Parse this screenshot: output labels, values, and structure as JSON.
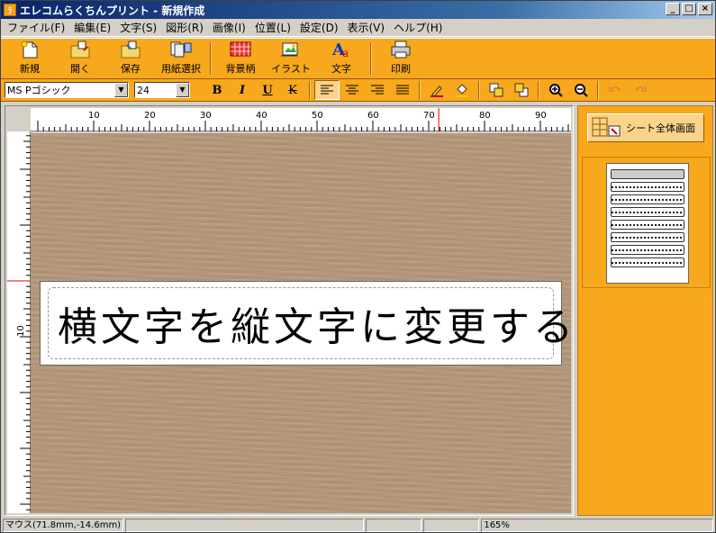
{
  "window": {
    "title": "エレコムらくちんプリント - 新規作成",
    "app_icon_text": "ﾗ",
    "buttons": {
      "minimize": "_",
      "maximize": "□",
      "close": "×"
    }
  },
  "menu": [
    "ファイル(F)",
    "編集(E)",
    "文字(S)",
    "図形(R)",
    "画像(I)",
    "位置(L)",
    "設定(D)",
    "表示(V)",
    "ヘルプ(H)"
  ],
  "toolbar": {
    "new": "新規",
    "open": "開く",
    "save": "保存",
    "paper": "用紙選択",
    "background": "背景柄",
    "illustration": "イラスト",
    "text": "文字",
    "print": "印刷"
  },
  "format": {
    "font_name": "MS Pゴシック",
    "font_size": "24",
    "bold": "B",
    "italic": "I",
    "underline": "U",
    "strike": "K"
  },
  "ruler": {
    "h_ticks": [
      "10",
      "20",
      "30",
      "40",
      "50",
      "60",
      "70",
      "80",
      "90"
    ],
    "v_label": "10"
  },
  "label_text": "横文字を縦文字に変更する",
  "side": {
    "sheet_button": "シート全体画面"
  },
  "status": {
    "mouse": "マウス(71.8mm,-14.6mm)",
    "zoom": "165%"
  },
  "colors": {
    "toolbar_bg": "#f7a81c",
    "canvas_bg": "#b3977a",
    "titlebar": "#0a246a"
  }
}
